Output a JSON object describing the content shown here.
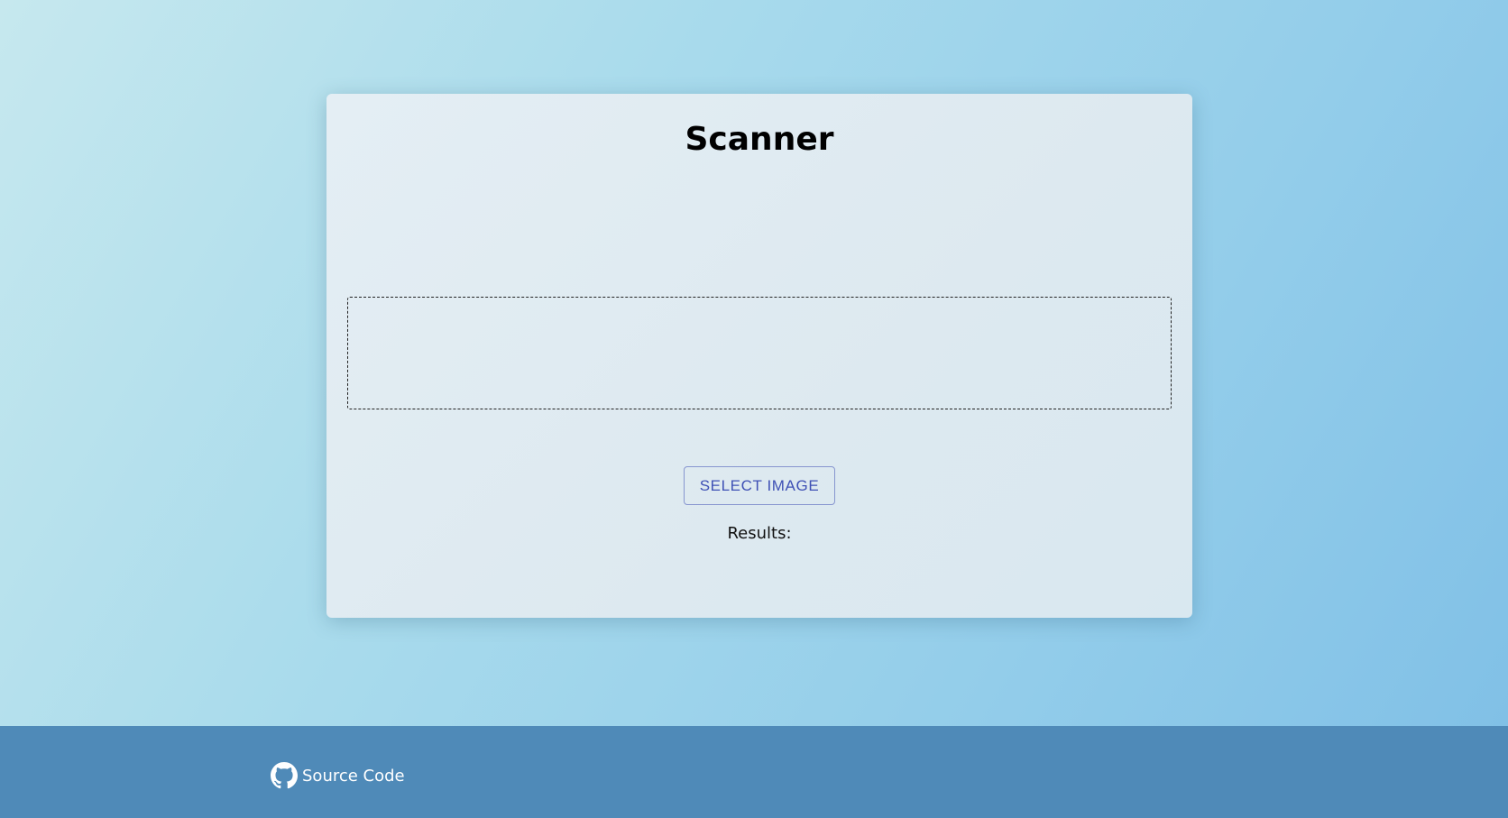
{
  "card": {
    "title": "Scanner",
    "select_button_label": "SELECT IMAGE",
    "results_label": "Results:"
  },
  "footer": {
    "source_link_label": "Source Code",
    "icon": "github-icon"
  },
  "colors": {
    "footer_bg": "#4f8ab8",
    "button_accent": "#3f51b5"
  }
}
